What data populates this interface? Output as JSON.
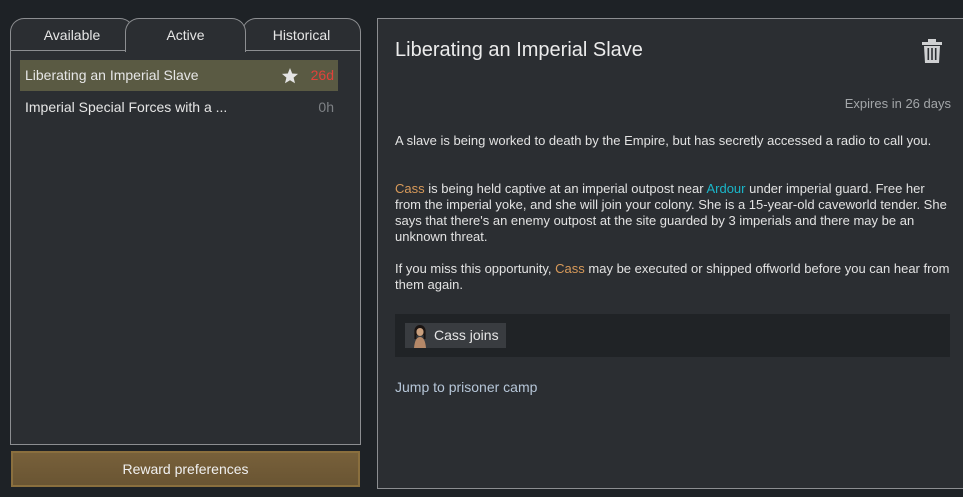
{
  "tabs": [
    {
      "label": "Available"
    },
    {
      "label": "Active"
    },
    {
      "label": "Historical"
    }
  ],
  "quests": [
    {
      "name": "Liberating an Imperial Slave",
      "time": "26d",
      "starred": true,
      "selected": true
    },
    {
      "name": "Imperial Special Forces with a ...",
      "time": "0h",
      "starred": false,
      "selected": false
    }
  ],
  "reward_preferences_label": "Reward preferences",
  "detail": {
    "title": "Liberating an Imperial Slave",
    "expires": "Expires in 26 days",
    "p1": "A slave is being worked to death by the Empire, but has secretly accessed a radio to call you.",
    "p2": {
      "pawn": "Cass",
      "t1": " is being held captive at an imperial outpost near ",
      "place": "Ardour",
      "t2": " under imperial guard. Free her from the imperial yoke, and she will join your colony. She is a 15-year-old caveworld tender. She says that there's an enemy outpost at the site guarded by 3 imperials and there may be an unknown threat."
    },
    "p3": {
      "t1": "If you miss this opportunity, ",
      "pawn": "Cass",
      "t2": " may be executed or shipped offworld before you can hear from them again."
    },
    "reward": "Cass joins",
    "jump_link": "Jump to prisoner camp"
  },
  "icons": {
    "star": "star-icon",
    "trash": "trash-icon",
    "portrait": "pawn-portrait-icon"
  },
  "colors": {
    "pawn_name": "#d89a5a",
    "place_name": "#1ab6c9",
    "urgent_time": "#e0423a",
    "selected_row": "#5a5a43"
  }
}
